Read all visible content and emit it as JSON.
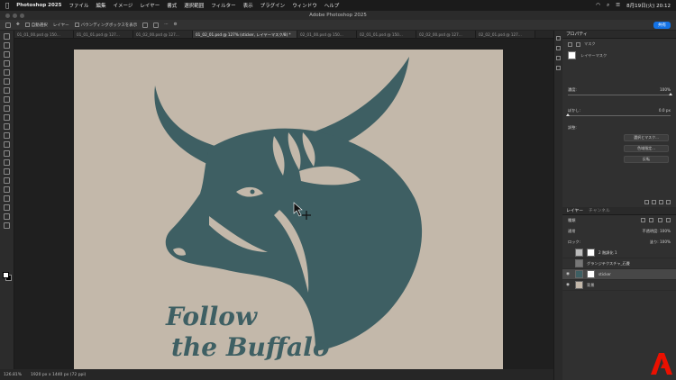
{
  "menubar": {
    "app": "Photoshop 2025",
    "items": [
      "ファイル",
      "編集",
      "イメージ",
      "レイヤー",
      "書式",
      "選択範囲",
      "フィルター",
      "表示",
      "プラグイン",
      "ウィンドウ",
      "ヘルプ"
    ],
    "datetime": "8月19日(火) 20:12"
  },
  "window": {
    "title": "Adobe Photoshop 2025"
  },
  "options": {
    "auto_select": "自動選択",
    "target": "レイヤー",
    "bounding_box": "バウンディングボックスを表示",
    "share": "共有"
  },
  "tabs": [
    {
      "label": "01_01_00.psd @ 150...",
      "active": false
    },
    {
      "label": "01_01_01.psd @ 127...",
      "active": false
    },
    {
      "label": "01_02_00.psd @ 127...",
      "active": false
    },
    {
      "label": "01_02_01.psd @ 127% (sticker, レイヤーマスク/8) *",
      "active": true
    },
    {
      "label": "02_01_00.psd @ 150...",
      "active": false
    },
    {
      "label": "02_01_01.psd @ 150...",
      "active": false
    },
    {
      "label": "02_02_00.psd @ 127...",
      "active": false
    },
    {
      "label": "02_02_01.psd @ 127...",
      "active": false
    }
  ],
  "artwork": {
    "line1": "Follow",
    "line2": "the Buffalo",
    "background_color": "#c3b8aa",
    "ink_color": "#3e5f63"
  },
  "status": {
    "zoom": "126.81%",
    "doc": "1920 px x 1440 px (72 ppi)"
  },
  "properties": {
    "tab": "プロパティ",
    "sub": "マスク",
    "mask_label": "レイヤーマスク",
    "density_label": "濃度:",
    "density_value": "100%",
    "density_fraction": 1.0,
    "feather_label": "ぼかし:",
    "feather_value": "0.0 px",
    "feather_fraction": 0.0,
    "refine_label": "調整:",
    "btn_select_mask": "選択とマスク...",
    "btn_color_range": "色域指定...",
    "btn_invert": "反転"
  },
  "layers_panel": {
    "tab1": "レイヤー",
    "tab2": "チャンネル",
    "filter": "種類",
    "blend": "通常",
    "opacity_label": "不透明度:",
    "opacity_value": "100%",
    "lock_label": "ロック:",
    "fill_label": "塗り:",
    "fill_value": "100%",
    "layers": [
      {
        "name": "2 階調化 1",
        "selected": false
      },
      {
        "name": "グランジテクスチャ_石畳",
        "selected": false
      },
      {
        "name": "sticker",
        "selected": true
      },
      {
        "name": "背景",
        "selected": false
      }
    ]
  },
  "colors": {
    "accent": "#1473e6",
    "adobe_red": "#eb1000"
  }
}
